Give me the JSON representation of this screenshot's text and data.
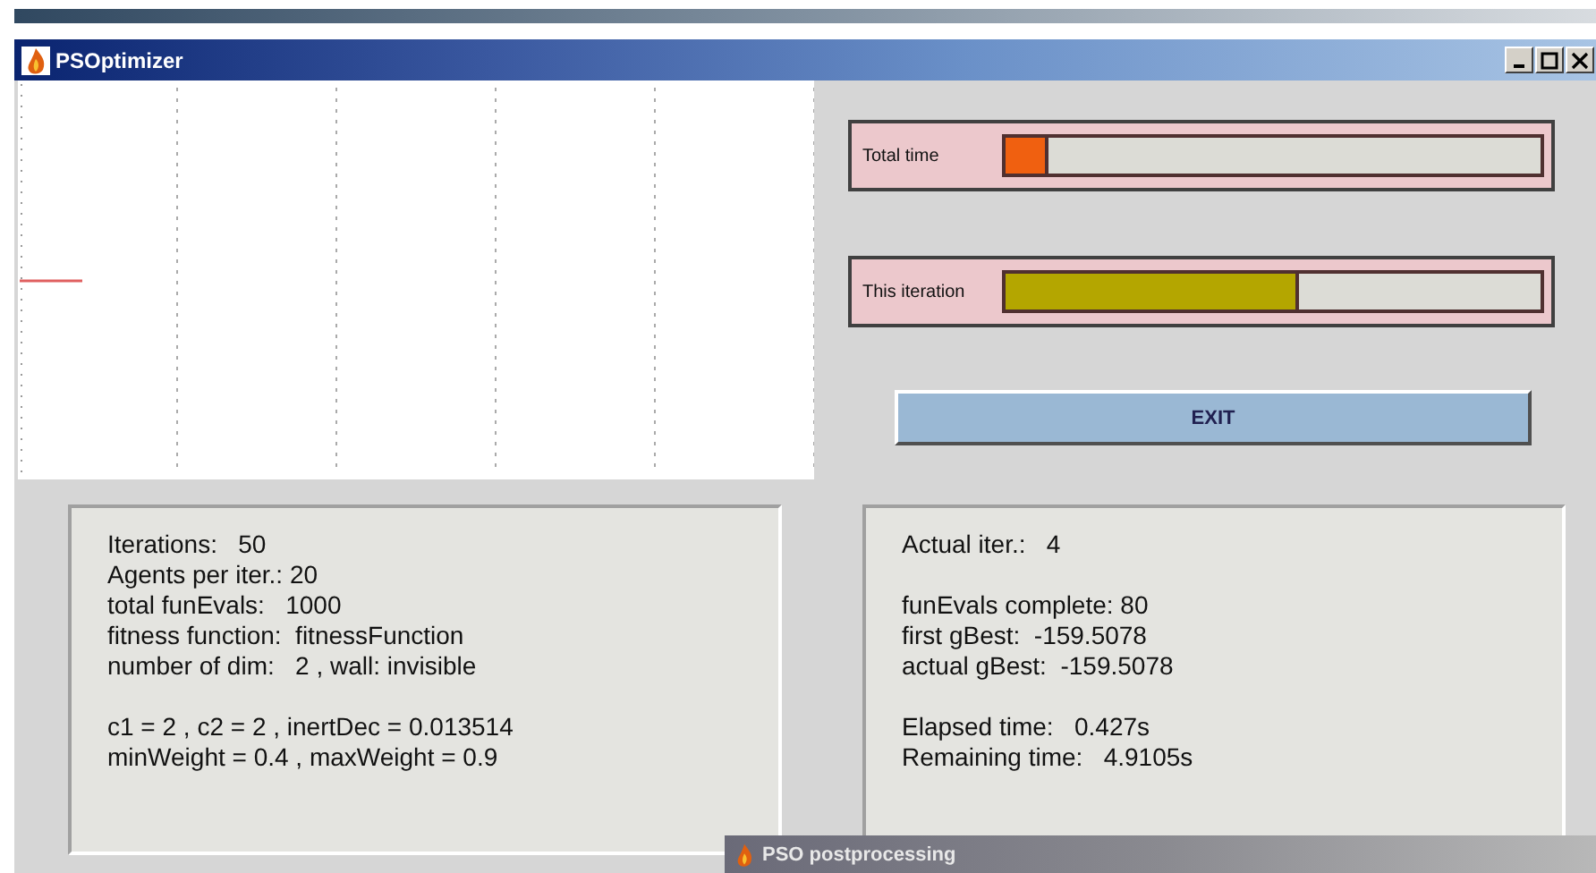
{
  "window": {
    "title": "PSOptimizer"
  },
  "progress": [
    {
      "label": "Total time",
      "level": 0.08,
      "color": "#f06010"
    },
    {
      "label": "This iteration",
      "level": 0.55,
      "color": "#b4a600"
    }
  ],
  "exit_button": {
    "label": "EXIT"
  },
  "params_panel": {
    "groups": [
      [
        "Iterations:   50",
        "Agents per iter.: 20",
        "total funEvals:   1000",
        "fitness function:  fitnessFunction",
        "number of dim:   2 , wall: invisible"
      ],
      [
        "c1 = 2 , c2 = 2 , inertDec = 0.013514",
        "minWeight = 0.4 , maxWeight = 0.9"
      ]
    ]
  },
  "status_panel": {
    "groups": [
      [
        "Actual iter.:   4"
      ],
      [
        "funEvals complete: 80",
        "first gBest:  -159.5078",
        "actual gBest:  -159.5078"
      ],
      [
        "Elapsed time:   0.427s",
        "Remaining time:   4.9105s"
      ]
    ]
  },
  "second_window": {
    "title": "PSO postprocessing"
  }
}
